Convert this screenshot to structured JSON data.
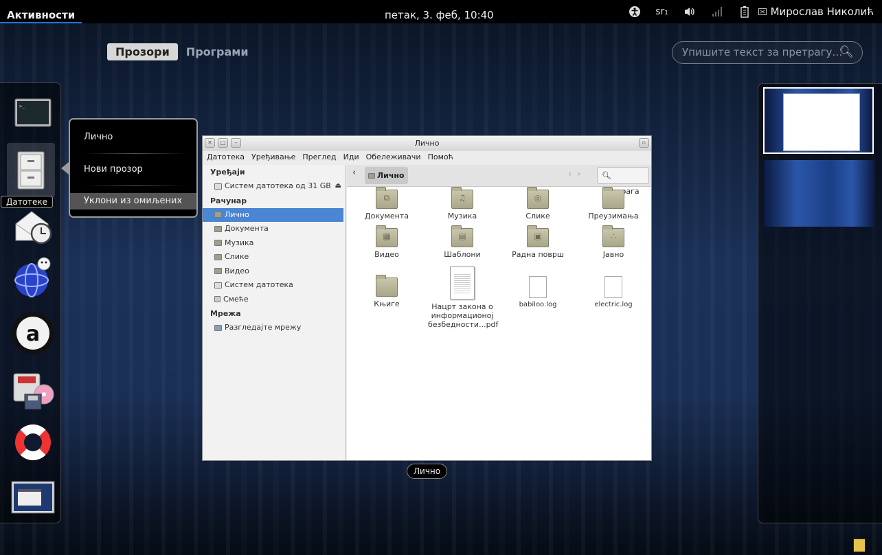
{
  "topbar": {
    "activities": "Активности",
    "clock": "петак,  3. феб, 10:40",
    "keyboard": "sr₁",
    "username": "Мирослав Николић"
  },
  "view": {
    "tabs": [
      "Прозори",
      "Програми"
    ],
    "active_tab": 0,
    "search_placeholder": "Упишите текст за претрагу…"
  },
  "dash": {
    "items": [
      "terminal",
      "files",
      "mail-clock",
      "browser",
      "software-center",
      "backup",
      "help",
      "screenshot"
    ],
    "hovered_label": "Датотеке"
  },
  "popup_menu": {
    "items": [
      "Лично",
      "Нови прозор",
      "Уклони из омиљених"
    ],
    "highlighted": 2
  },
  "window": {
    "title": "Лично",
    "label": "Лично",
    "menu": [
      "Датотека",
      "Уређивање",
      "Преглед",
      "Иди",
      "Обележивачи",
      "Помоћ"
    ],
    "sidebar": {
      "devices_header": "Уређаји",
      "devices": [
        "Систем датотека од 31 GB"
      ],
      "computer_header": "Рачунар",
      "computer": [
        "Лично",
        "Документа",
        "Музика",
        "Слике",
        "Видео",
        "Систем датотека",
        "Смеће"
      ],
      "selected": "Лично",
      "network_header": "Мрежа",
      "network": [
        "Разгледајте мрежу"
      ]
    },
    "path": "Лично",
    "search_label": "Претрага",
    "files": [
      {
        "name": "Документа",
        "kind": "folder",
        "glyph": "⧉"
      },
      {
        "name": "Музика",
        "kind": "folder",
        "glyph": "♫"
      },
      {
        "name": "Слике",
        "kind": "folder",
        "glyph": "◎"
      },
      {
        "name": "Преузимања",
        "kind": "folder",
        "glyph": ""
      },
      {
        "name": "Видео",
        "kind": "folder",
        "glyph": "▦"
      },
      {
        "name": "Шаблони",
        "kind": "folder",
        "glyph": "▤"
      },
      {
        "name": "Радна површ",
        "kind": "folder",
        "glyph": "▣"
      },
      {
        "name": "Јавно",
        "kind": "folder",
        "glyph": "∴"
      },
      {
        "name": "Књиге",
        "kind": "folder",
        "glyph": ""
      },
      {
        "name": "Нацрт закона о информационој безбедности...pdf",
        "kind": "pdf",
        "glyph": ""
      },
      {
        "name": "babiloo.log",
        "kind": "doc",
        "glyph": ""
      },
      {
        "name": "electric.log",
        "kind": "doc",
        "glyph": ""
      }
    ]
  },
  "workspaces": {
    "count": 2,
    "active": 0
  }
}
